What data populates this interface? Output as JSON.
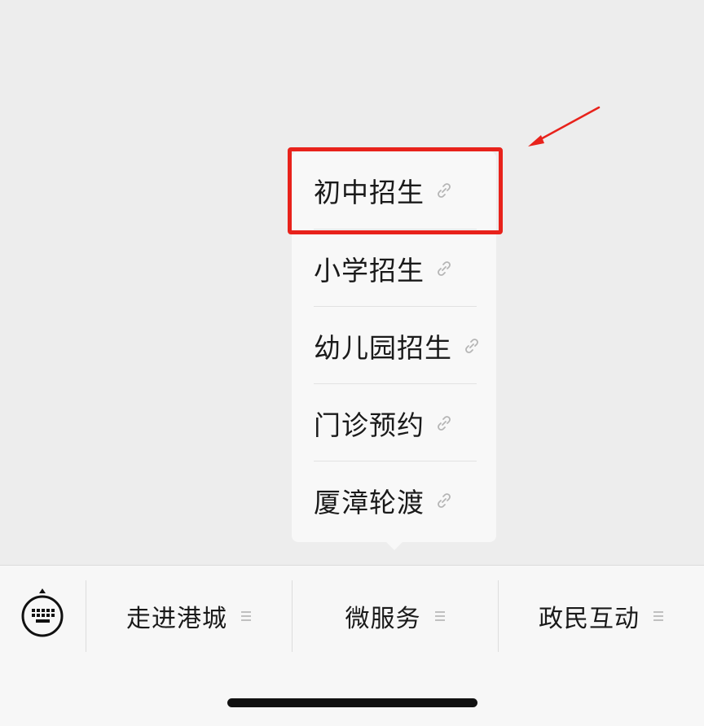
{
  "submenu": {
    "items": [
      {
        "label": "初中招生",
        "icon": "link-icon"
      },
      {
        "label": "小学招生",
        "icon": "link-icon"
      },
      {
        "label": "幼儿园招生",
        "icon": "link-icon"
      },
      {
        "label": "门诊预约",
        "icon": "link-icon"
      },
      {
        "label": "厦漳轮渡",
        "icon": "link-icon"
      }
    ]
  },
  "bottom_menu": {
    "keyboard_icon": "keyboard-icon",
    "tabs": [
      {
        "label": "走进港城",
        "icon": "menu-lines-icon"
      },
      {
        "label": "微服务",
        "icon": "menu-lines-icon"
      },
      {
        "label": "政民互动",
        "icon": "menu-lines-icon"
      }
    ]
  },
  "colors": {
    "highlight": "#e8221b",
    "background": "#ededed",
    "menu_bg": "#f8f8f8",
    "text": "#1a1a1a",
    "icon_gray": "#b5b5b5"
  }
}
